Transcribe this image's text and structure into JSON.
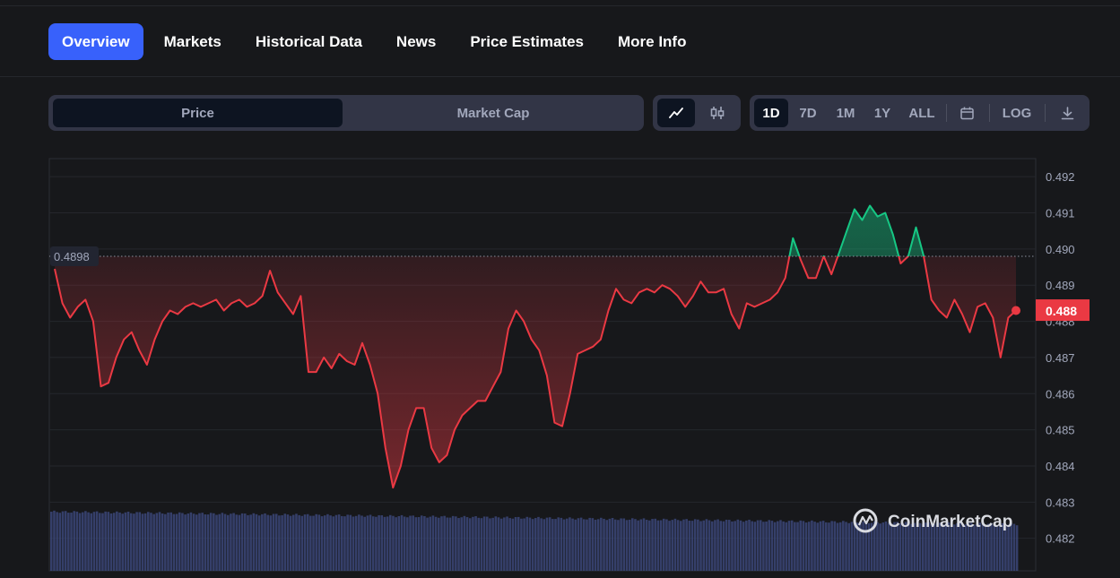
{
  "nav": {
    "tabs": [
      {
        "label": "Overview",
        "active": true
      },
      {
        "label": "Markets"
      },
      {
        "label": "Historical Data"
      },
      {
        "label": "News"
      },
      {
        "label": "Price Estimates"
      },
      {
        "label": "More Info"
      }
    ]
  },
  "toolbar": {
    "metric_tabs": [
      {
        "label": "Price",
        "active": true
      },
      {
        "label": "Market Cap"
      }
    ],
    "chart_mode_icons": [
      "line-chart-icon",
      "candlestick-icon"
    ],
    "ranges": [
      {
        "label": "1D",
        "active": true
      },
      {
        "label": "7D"
      },
      {
        "label": "1M"
      },
      {
        "label": "1Y"
      },
      {
        "label": "ALL"
      }
    ],
    "calendar_icon": "calendar-icon",
    "log_label": "LOG",
    "download_icon": "download-icon"
  },
  "colors": {
    "background": "#17181b",
    "accent": "#3861fb",
    "up": "#16c784",
    "down": "#ea3943",
    "volume": "#3b4678",
    "grid": "#25272c"
  },
  "watermark": "CoinMarketCap",
  "chart_data": {
    "type": "line",
    "y_ticks": [
      "0.492",
      "0.491",
      "0.490",
      "0.489",
      "0.488",
      "0.487",
      "0.486",
      "0.485",
      "0.484",
      "0.483",
      "0.482"
    ],
    "ylim": [
      0.4811,
      0.4925
    ],
    "reference_label": "0.4898",
    "reference_value": 0.4898,
    "current_label": "0.488",
    "current_value": 0.48831,
    "grid": true,
    "volume_bars": true,
    "series": [
      {
        "values": [
          0.48945,
          0.4885,
          0.4881,
          0.4884,
          0.4886,
          0.488,
          0.4862,
          0.4863,
          0.487,
          0.4875,
          0.4877,
          0.4872,
          0.4868,
          0.4875,
          0.488,
          0.4883,
          0.4882,
          0.4884,
          0.4885,
          0.4884,
          0.4885,
          0.4886,
          0.4883,
          0.4885,
          0.4886,
          0.4884,
          0.4885,
          0.4887,
          0.4894,
          0.4888,
          0.4885,
          0.4882,
          0.4887,
          0.4866,
          0.4866,
          0.487,
          0.4867,
          0.4871,
          0.4869,
          0.4868,
          0.4874,
          0.4868,
          0.486,
          0.4845,
          0.4834,
          0.484,
          0.485,
          0.4856,
          0.4856,
          0.4845,
          0.4841,
          0.4843,
          0.485,
          0.4854,
          0.4856,
          0.4858,
          0.4858,
          0.4862,
          0.4866,
          0.4878,
          0.4883,
          0.488,
          0.4875,
          0.4872,
          0.4865,
          0.4852,
          0.4851,
          0.486,
          0.4871,
          0.4872,
          0.4873,
          0.4875,
          0.4883,
          0.4889,
          0.4886,
          0.4885,
          0.4888,
          0.4889,
          0.4888,
          0.489,
          0.4889,
          0.4887,
          0.4884,
          0.4887,
          0.4891,
          0.4888,
          0.4888,
          0.4889,
          0.4882,
          0.4878,
          0.4885,
          0.4884,
          0.4885,
          0.4886,
          0.4888,
          0.4892,
          0.4903,
          0.4897,
          0.4892,
          0.4892,
          0.4898,
          0.4893,
          0.4899,
          0.4905,
          0.4911,
          0.4908,
          0.4912,
          0.4909,
          0.491,
          0.4904,
          0.4896,
          0.4898,
          0.4906,
          0.4898,
          0.4886,
          0.4883,
          0.4881,
          0.4886,
          0.4882,
          0.4877,
          0.4884,
          0.4885,
          0.4881,
          0.487,
          0.4881,
          0.4883
        ]
      }
    ]
  }
}
